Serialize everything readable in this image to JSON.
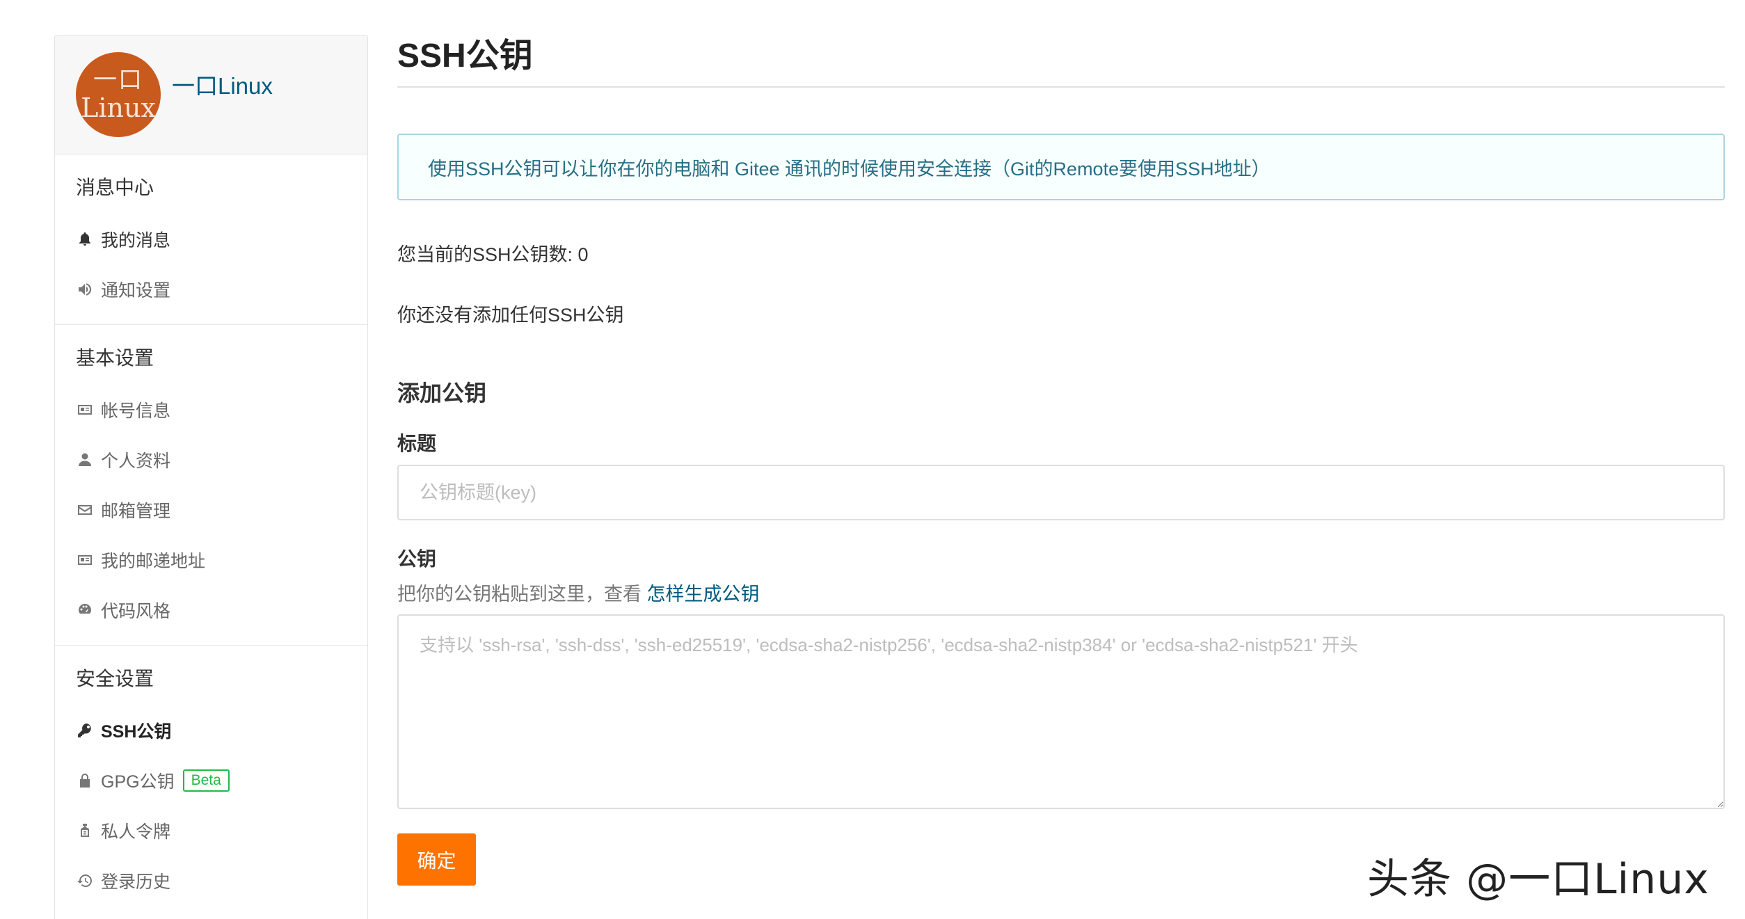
{
  "profile": {
    "avatar_line1": "一口",
    "avatar_line2": "Linux",
    "name": "一口Linux"
  },
  "sidebar": {
    "sections": [
      {
        "title": "消息中心",
        "items": [
          {
            "label": "我的消息",
            "icon": "bell-icon"
          },
          {
            "label": "通知设置",
            "icon": "speaker-icon"
          }
        ]
      },
      {
        "title": "基本设置",
        "items": [
          {
            "label": "帐号信息",
            "icon": "id-card-icon"
          },
          {
            "label": "个人资料",
            "icon": "user-icon"
          },
          {
            "label": "邮箱管理",
            "icon": "envelope-icon"
          },
          {
            "label": "我的邮递地址",
            "icon": "address-card-icon"
          },
          {
            "label": "代码风格",
            "icon": "palette-icon"
          }
        ]
      },
      {
        "title": "安全设置",
        "items": [
          {
            "label": "SSH公钥",
            "icon": "key-icon",
            "active": true
          },
          {
            "label": "GPG公钥",
            "icon": "lock-icon",
            "badge": "Beta"
          },
          {
            "label": "私人令牌",
            "icon": "token-icon"
          },
          {
            "label": "登录历史",
            "icon": "history-icon"
          }
        ]
      }
    ]
  },
  "main": {
    "title": "SSH公钥",
    "info": "使用SSH公钥可以让你在你的电脑和 Gitee 通讯的时候使用安全连接（Git的Remote要使用SSH地址）",
    "count_text": "您当前的SSH公钥数: 0",
    "empty_text": "你还没有添加任何SSH公钥",
    "add_title": "添加公钥",
    "title_label": "标题",
    "title_placeholder": "公钥标题(key)",
    "key_label": "公钥",
    "key_hint": "把你的公钥粘贴到这里，查看 ",
    "key_hint_link": "怎样生成公钥",
    "key_placeholder": "支持以 'ssh-rsa', 'ssh-dss', 'ssh-ed25519', 'ecdsa-sha2-nistp256', 'ecdsa-sha2-nistp384' or 'ecdsa-sha2-nistp521' 开头",
    "submit_label": "确定"
  },
  "watermark": "头条 @一口Linux",
  "colors": {
    "accent": "#fe7300",
    "link": "#005980",
    "info_border": "#a9d5de",
    "beta": "#21ba45",
    "avatar_bg": "#c85a1e"
  }
}
